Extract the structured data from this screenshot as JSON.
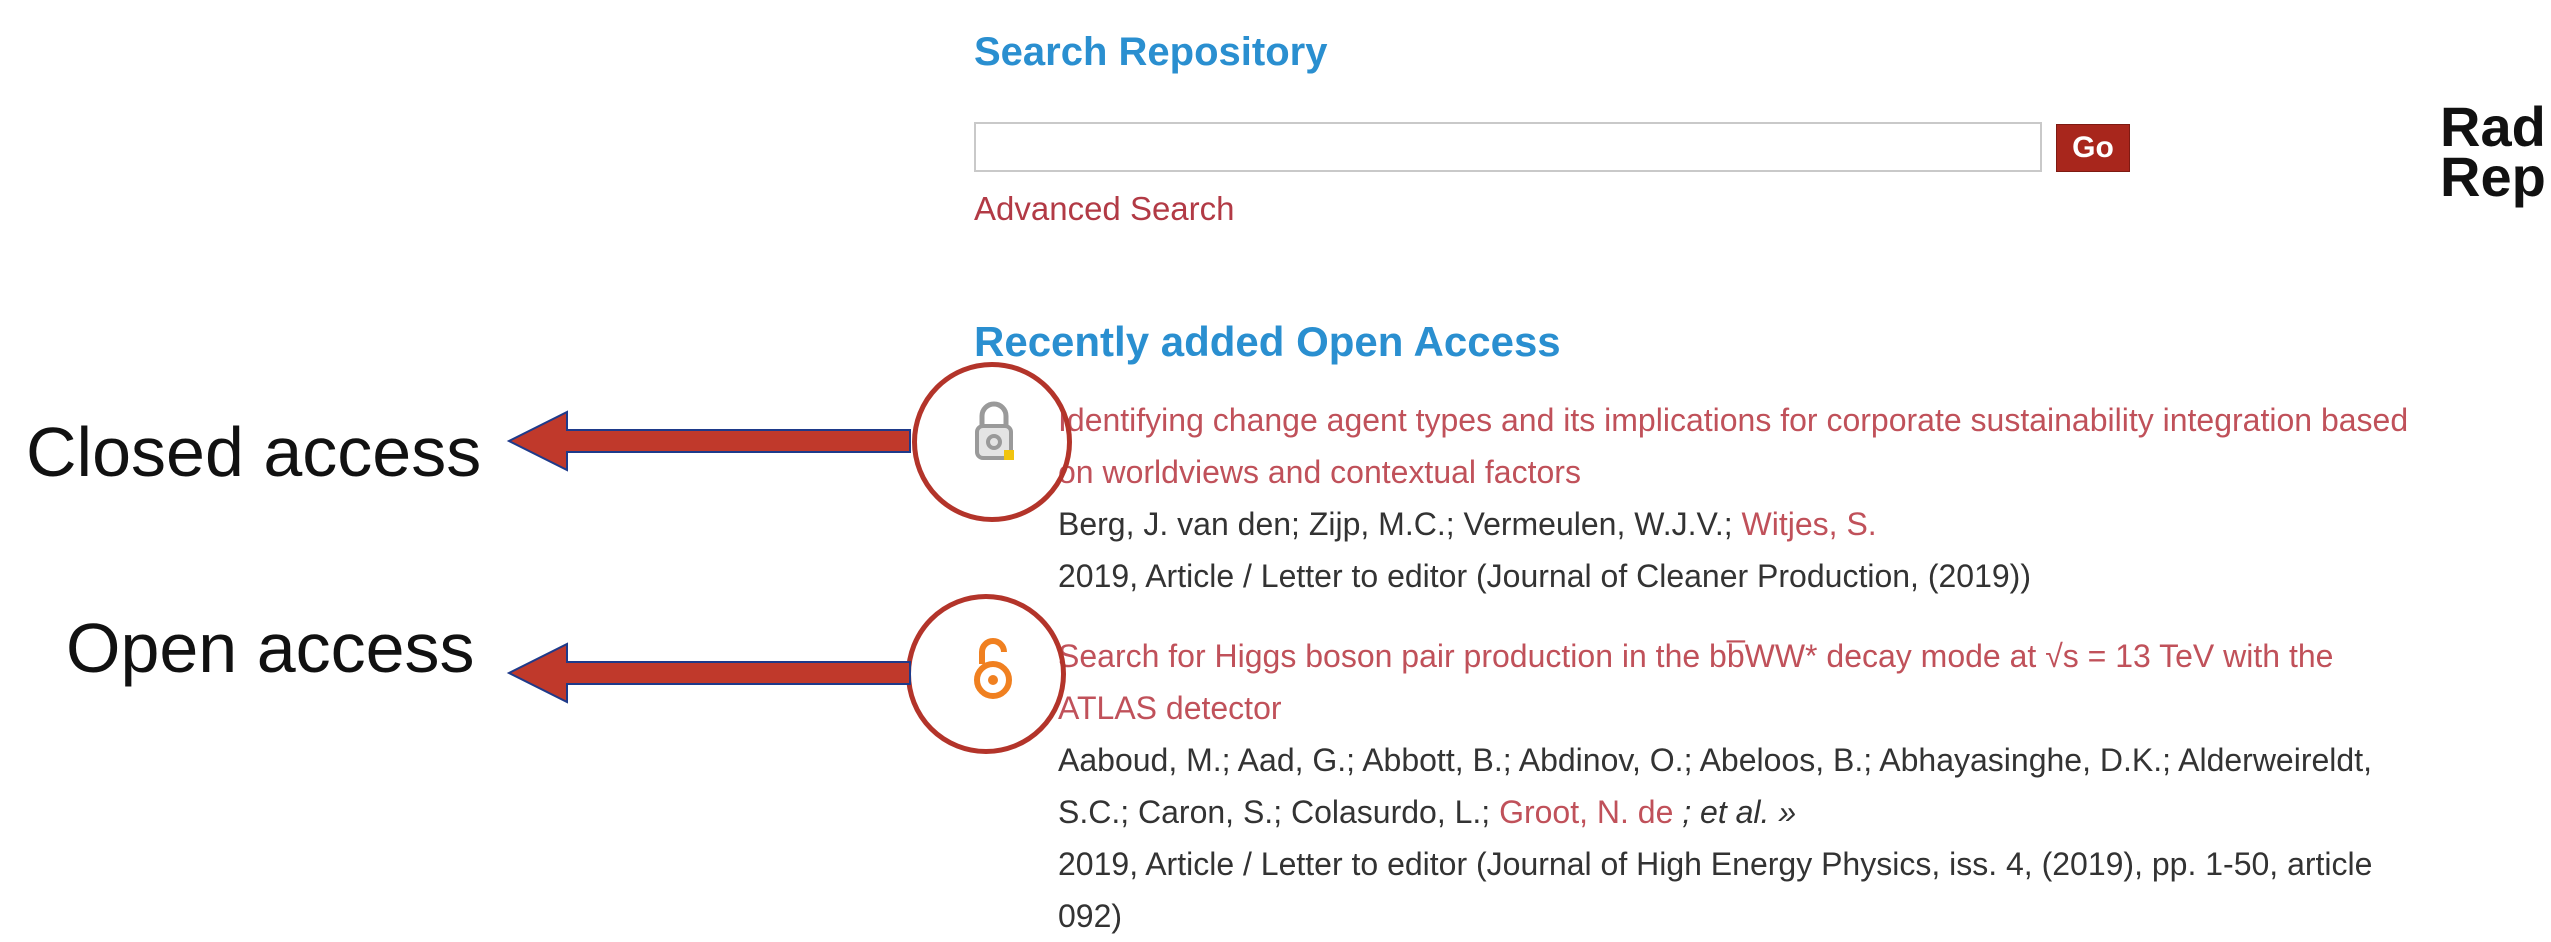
{
  "search": {
    "title": "Search Repository",
    "go_label": "Go",
    "advanced_label": "Advanced Search",
    "value": "",
    "placeholder": ""
  },
  "logo": {
    "line1": "Rad",
    "line2": "Rep"
  },
  "recent": {
    "title": "Recently added Open Access",
    "items": [
      {
        "access": "closed",
        "icon": "closed-lock-icon",
        "title_line1": "Identifying change agent types and its implications for corporate sustainability integration based",
        "title_line2": "on worldviews and contextual factors",
        "authors_plain": "Berg, J. van den; Zijp, M.C.; Vermeulen, W.J.V.; ",
        "authors_link": "Witjes, S.",
        "pub": "2019, Article / Letter to editor (Journal of Cleaner Production, (2019))"
      },
      {
        "access": "open",
        "icon": "open-access-icon",
        "title_line1": "Search for Higgs boson pair production in the bb̅WW* decay mode at √s = 13 TeV with the",
        "title_line2": "ATLAS detector",
        "authors_line1": "Aaboud, M.; Aad, G.; Abbott, B.; Abdinov, O.; Abeloos, B.; Abhayasinghe, D.K.; Alderweireldt,",
        "authors_line2_plain": "S.C.; Caron, S.; Colasurdo, L.; ",
        "authors_line2_link": "Groot, N. de",
        "authors_etal": " ; et al. »",
        "pub_line1": "2019, Article / Letter to editor (Journal of High Energy Physics, iss. 4, (2019), pp. 1-50, article",
        "pub_line2": "092)"
      }
    ]
  },
  "annotations": {
    "closed_label": "Closed access",
    "open_label": "Open access",
    "arrow_color": "#c0392b",
    "circle_color": "#b3342a"
  },
  "colors": {
    "heading_blue": "#2a8fd0",
    "link_red": "#c0515a",
    "go_button": "#a8261c",
    "open_access_orange": "#f08020"
  }
}
